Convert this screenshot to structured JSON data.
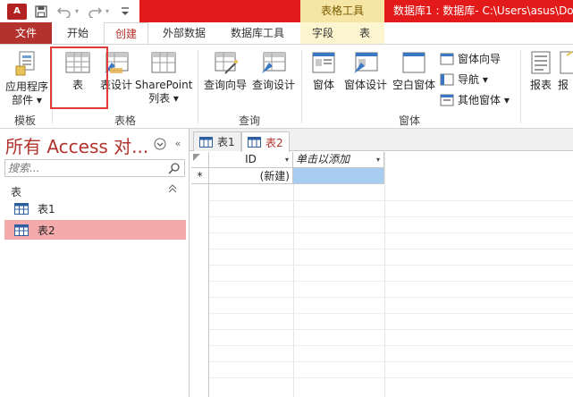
{
  "titlebar": {
    "context_tab": "表格工具",
    "title": "数据库1 : 数据库- C:\\Users\\asus\\Do",
    "app_logo": "A",
    "qat_icons": [
      "save-icon",
      "undo-icon",
      "redo-icon",
      "customize-qat-icon"
    ],
    "colors": {
      "title_band": "#e21a1a",
      "context_band": "#f6e6a6"
    }
  },
  "tabs": {
    "file": "文件",
    "items": [
      "开始",
      "创建",
      "外部数据",
      "数据库工具",
      "字段",
      "表"
    ],
    "active": "创建"
  },
  "ribbon": {
    "groups": {
      "templates": {
        "label": "模板",
        "app_parts_line1": "应用程序",
        "app_parts_line2": "部件 ▾"
      },
      "tables": {
        "label": "表格",
        "table": "表",
        "table_design": "表设计",
        "sharepoint_line1": "SharePoint",
        "sharepoint_line2": "列表 ▾"
      },
      "queries": {
        "label": "查询",
        "query_wizard": "查询向导",
        "query_design": "查询设计"
      },
      "forms": {
        "label": "窗体",
        "form": "窗体",
        "form_design": "窗体设计",
        "blank_form": "空白窗体",
        "form_wizard": "窗体向导",
        "navigation": "导航 ▾",
        "more_forms": "其他窗体 ▾"
      },
      "reports": {
        "report": "报表",
        "report_partial": "报"
      }
    }
  },
  "navpane": {
    "title": "所有 Access 对...",
    "search_placeholder": "搜索...",
    "group_label": "表",
    "items": [
      {
        "label": "表1",
        "selected": false
      },
      {
        "label": "表2",
        "selected": true
      }
    ]
  },
  "document": {
    "tabs": [
      {
        "label": "表1",
        "active": false
      },
      {
        "label": "表2",
        "active": true
      }
    ],
    "grid": {
      "columns": [
        "ID",
        "单击以添加"
      ],
      "new_row_marker": "*",
      "new_row_value": "(新建)"
    }
  }
}
